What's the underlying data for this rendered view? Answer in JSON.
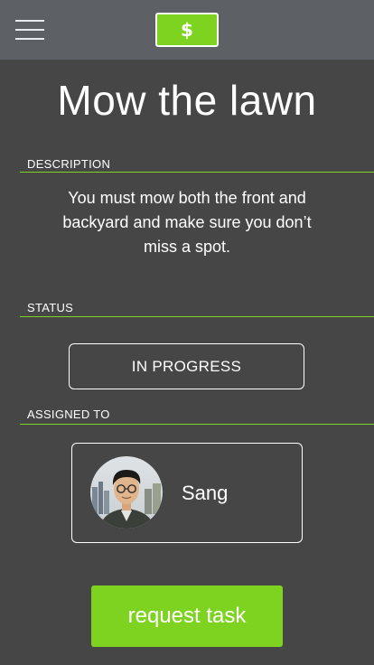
{
  "header": {
    "menu_icon": "hamburger-menu-icon",
    "currency_icon": "dollar-icon",
    "currency_symbol": "$",
    "accent_color": "#7ed321"
  },
  "task": {
    "title": "Mow the lawn",
    "description_label": "DESCRIPTION",
    "description": "You must mow both the front and backyard and make sure you don’t miss a spot.",
    "status_label": "STATUS",
    "status": "IN PROGRESS",
    "assigned_label": "ASSIGNED TO",
    "assignee": {
      "name": "Sang",
      "avatar_icon": "user-photo"
    }
  },
  "actions": {
    "request_label": "request task"
  }
}
